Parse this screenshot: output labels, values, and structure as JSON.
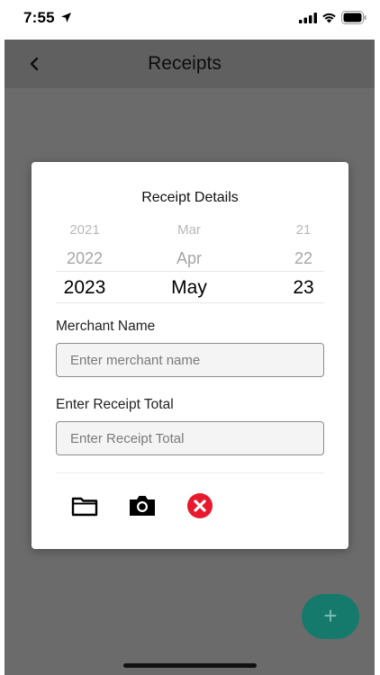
{
  "status_bar": {
    "time": "7:55"
  },
  "app_bar": {
    "title": "Receipts"
  },
  "dialog": {
    "title": "Receipt Details",
    "date_picker": {
      "years": [
        "2021",
        "2022",
        "2023"
      ],
      "months": [
        "Mar",
        "Apr",
        "May"
      ],
      "days": [
        "21",
        "22",
        "23"
      ],
      "selected": {
        "year": "2023",
        "month": "May",
        "day": "23"
      }
    },
    "merchant": {
      "label": "Merchant Name",
      "placeholder": "Enter merchant name",
      "value": ""
    },
    "total": {
      "label": "Enter Receipt Total",
      "placeholder": "Enter Receipt Total",
      "value": ""
    },
    "actions": [
      {
        "icon": "folder-icon"
      },
      {
        "icon": "camera-icon"
      },
      {
        "icon": "close-circle-icon",
        "color": "#e8192c"
      }
    ]
  },
  "fab": {
    "label": "+",
    "color": "#157a6b"
  },
  "colors": {
    "accent": "#157a6b",
    "danger": "#e8192c"
  }
}
